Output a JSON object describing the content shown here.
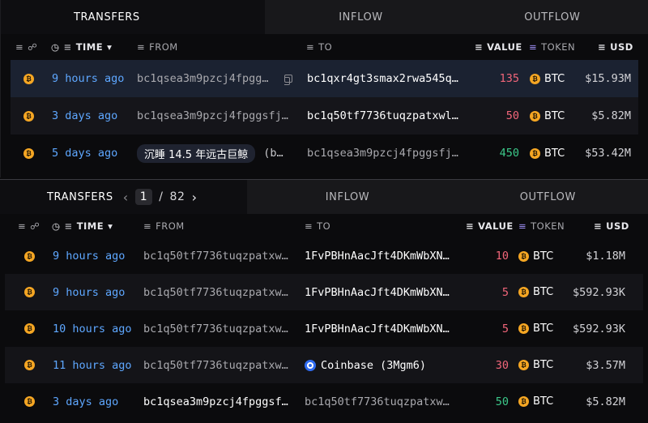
{
  "icons": {
    "filter": "filter-icon",
    "link": "link-icon",
    "clock": "clock-icon",
    "sort_down": "sort-desc-icon",
    "copy": "copy-icon",
    "btc": "bitcoin-icon",
    "coinbase": "coinbase-icon"
  },
  "colors": {
    "accent_blue": "#5ea7ff",
    "value_out": "#f2667a",
    "value_in": "#3cc98a",
    "btc": "#f5a623"
  },
  "panel1": {
    "tabs": [
      "TRANSFERS",
      "INFLOW",
      "OUTFLOW"
    ],
    "headers": {
      "time": "TIME",
      "from": "FROM",
      "to": "TO",
      "value": "VALUE",
      "token": "TOKEN",
      "usd": "USD"
    },
    "rows": [
      {
        "time": "9 hours ago",
        "from": "bc1qsea3m9pzcj4fpgg…",
        "to": "bc1qxr4gt3smax2rwa545q…",
        "value": "135",
        "token": "BTC",
        "usd": "$15.93M"
      },
      {
        "time": "3 days ago",
        "from": "bc1qsea3m9pzcj4fpggsfj…",
        "to": "bc1q50tf7736tuqzpatxwl…",
        "value": "50",
        "token": "BTC",
        "usd": "$5.82M"
      },
      {
        "time": "5 days ago",
        "from_entity": "沉睡 14.5 年远古巨鲸",
        "from_tail": "(b…",
        "to": "bc1qsea3m9pzcj4fpggsfj…",
        "value": "450",
        "token": "BTC",
        "usd": "$53.42M"
      }
    ]
  },
  "panel2": {
    "tabs": [
      "TRANSFERS",
      "INFLOW",
      "OUTFLOW"
    ],
    "pager": {
      "current": "1",
      "sep": "/",
      "total": "82"
    },
    "headers": {
      "time": "TIME",
      "from": "FROM",
      "to": "TO",
      "value": "VALUE",
      "token": "TOKEN",
      "usd": "USD"
    },
    "rows": [
      {
        "time": "9 hours ago",
        "from": "bc1q50tf7736tuqzpatxw…",
        "to": "1FvPBHnAacJft4DKmWbXN…",
        "value": "10",
        "token": "BTC",
        "usd": "$1.18M"
      },
      {
        "time": "9 hours ago",
        "from": "bc1q50tf7736tuqzpatxw…",
        "to": "1FvPBHnAacJft4DKmWbXN…",
        "value": "5",
        "token": "BTC",
        "usd": "$592.93K"
      },
      {
        "time": "10 hours ago",
        "from": "bc1q50tf7736tuqzpatxw…",
        "to": "1FvPBHnAacJft4DKmWbXN…",
        "value": "5",
        "token": "BTC",
        "usd": "$592.93K"
      },
      {
        "time": "11 hours ago",
        "from": "bc1q50tf7736tuqzpatxw…",
        "to": "Coinbase (3Mgm6)",
        "value": "30",
        "token": "BTC",
        "usd": "$3.57M"
      },
      {
        "time": "3 days ago",
        "from": "bc1qsea3m9pzcj4fpggsf…",
        "to": "bc1q50tf7736tuqzpatxw…",
        "value": "50",
        "token": "BTC",
        "usd": "$5.82M"
      }
    ]
  }
}
